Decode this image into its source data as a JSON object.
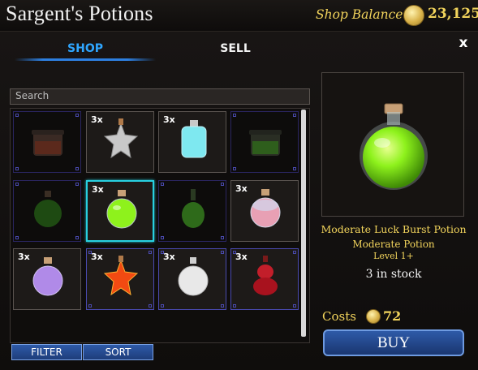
{
  "header": {
    "title": "Sargent's Potions",
    "balance_label": "Shop Balance",
    "balance_value": "23,125"
  },
  "tabs": [
    {
      "label": "SHOP",
      "active": true
    },
    {
      "label": "SELL",
      "active": false
    }
  ],
  "close_label": "x",
  "search": {
    "placeholder": "Search"
  },
  "grid": [
    {
      "qty": "",
      "potion": "dark-jar-red",
      "state": "dim"
    },
    {
      "qty": "3x",
      "potion": "silver-star",
      "state": "normal"
    },
    {
      "qty": "3x",
      "potion": "cyan-flask",
      "state": "normal"
    },
    {
      "qty": "",
      "potion": "dark-jar-green",
      "state": "dim"
    },
    {
      "qty": "",
      "potion": "dark-round-green",
      "state": "dim"
    },
    {
      "qty": "3x",
      "potion": "green-round",
      "state": "selected"
    },
    {
      "qty": "",
      "potion": "dark-bottle-green",
      "state": "dim"
    },
    {
      "qty": "3x",
      "potion": "pink-round",
      "state": "normal"
    },
    {
      "qty": "3x",
      "potion": "purple-round",
      "state": "normal"
    },
    {
      "qty": "3x",
      "potion": "orange-star",
      "state": "blueb"
    },
    {
      "qty": "3x",
      "potion": "white-round",
      "state": "blueb"
    },
    {
      "qty": "3x",
      "potion": "red-gourd",
      "state": "blueb"
    }
  ],
  "buttons": {
    "filter": "FILTER",
    "sort": "SORT",
    "buy": "BUY"
  },
  "detail": {
    "name": "Moderate Luck Burst Potion",
    "type": "Moderate Potion",
    "level": "Level 1+",
    "stock": "3 in stock",
    "cost_label": "Costs",
    "cost_value": "72"
  },
  "colors": {
    "accent_gold": "#f2d45c",
    "tab_active": "#2fa6ff",
    "selection": "#28d0e0",
    "button_blue": "#2e5aa8"
  }
}
